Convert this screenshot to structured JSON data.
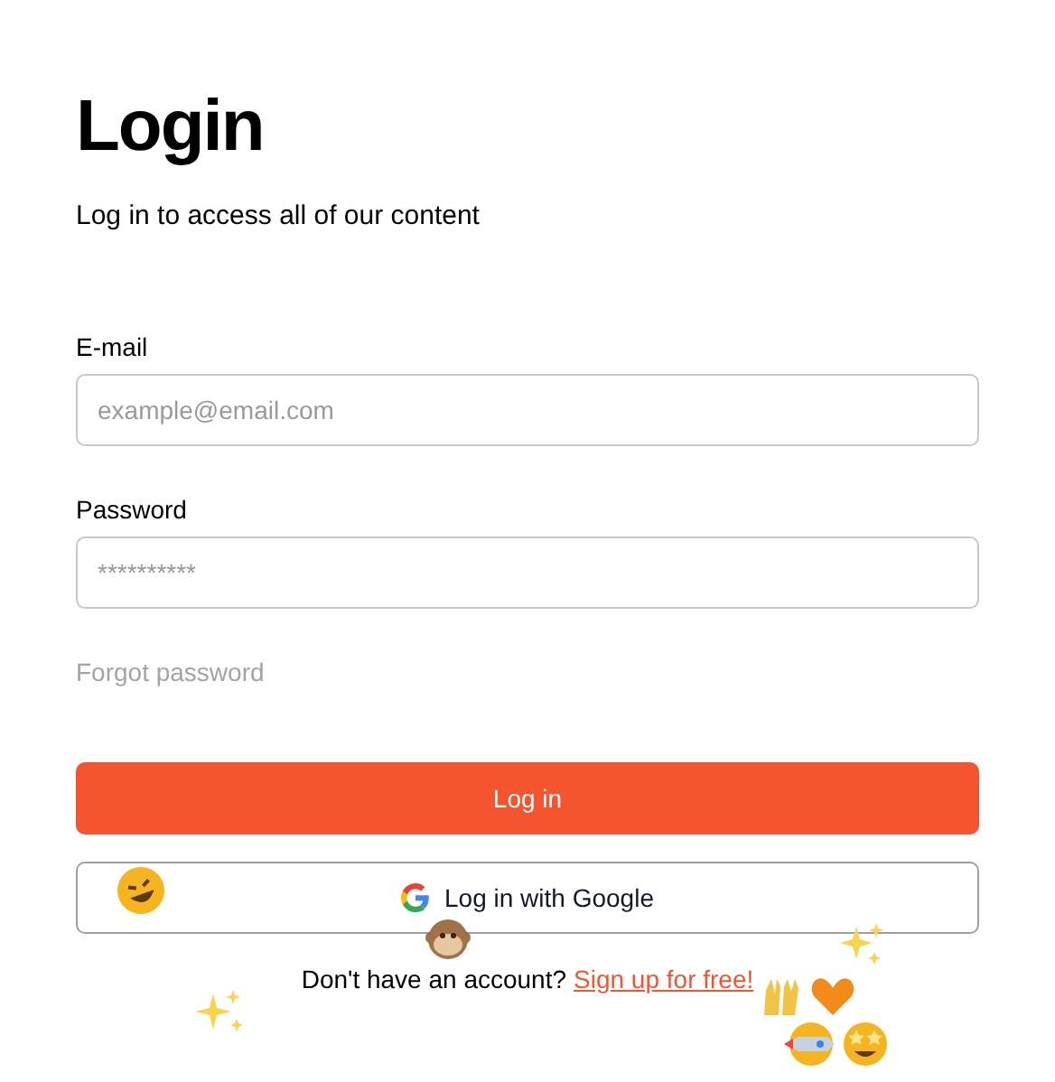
{
  "title": "Login",
  "subtitle": "Log in to access all of our content",
  "fields": [
    {
      "label": "E-mail",
      "placeholder": "example@email.com"
    },
    {
      "label": "Password",
      "placeholder": "**********"
    }
  ],
  "forgot_link": "Forgot password",
  "login_button": "Log in",
  "google_button": "Log in with Google",
  "signup": {
    "prompt": "Don't have an account?",
    "link": "Sign up for free!"
  }
}
